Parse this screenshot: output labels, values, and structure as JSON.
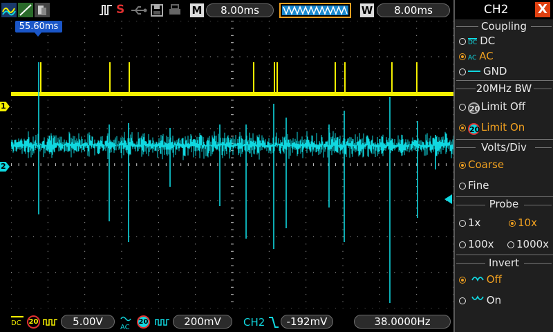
{
  "top_bar": {
    "run_state": "S",
    "mode_m": "M",
    "timebase": "8.00ms",
    "mode_w": "W",
    "window_timebase": "8.00ms"
  },
  "cursor": {
    "time": "55.60ms"
  },
  "channels": {
    "ch1_marker": "1",
    "ch2_marker": "2"
  },
  "bottom_bar": {
    "ch1_coupling": "DC",
    "ch1_bw": "20",
    "ch1_scale": "5.00V",
    "ch2_coupling": "AC",
    "ch2_bw": "20",
    "ch2_scale": "200mV",
    "trigger_source": "CH2",
    "trigger_level": "-192mV",
    "frequency": "38.0000Hz"
  },
  "side_menu": {
    "title": "CH2",
    "close": "X",
    "coupling": {
      "label": "Coupling",
      "dc": "DC",
      "dc_icon": "DC",
      "ac": "AC",
      "ac_icon": "AC",
      "gnd": "GND",
      "selected": "AC"
    },
    "bw": {
      "label": "20MHz BW",
      "icon": "20",
      "off": "Limit Off",
      "on": "Limit On",
      "selected": "Limit On"
    },
    "volts": {
      "label": "Volts/Div",
      "coarse": "Coarse",
      "fine": "Fine",
      "selected": "Coarse"
    },
    "probe": {
      "label": "Probe",
      "x1": "1x",
      "x10": "10x",
      "x100": "100x",
      "x1000": "1000x",
      "selected": "10x"
    },
    "invert": {
      "label": "Invert",
      "off": "Off",
      "on": "On",
      "selected": "Off"
    }
  },
  "colors": {
    "ch1": "#f5f000",
    "ch2": "#10d8e0",
    "accent": "#f0a020",
    "cursor_badge": "#1a56c8",
    "grid": "#bbbbbb"
  }
}
